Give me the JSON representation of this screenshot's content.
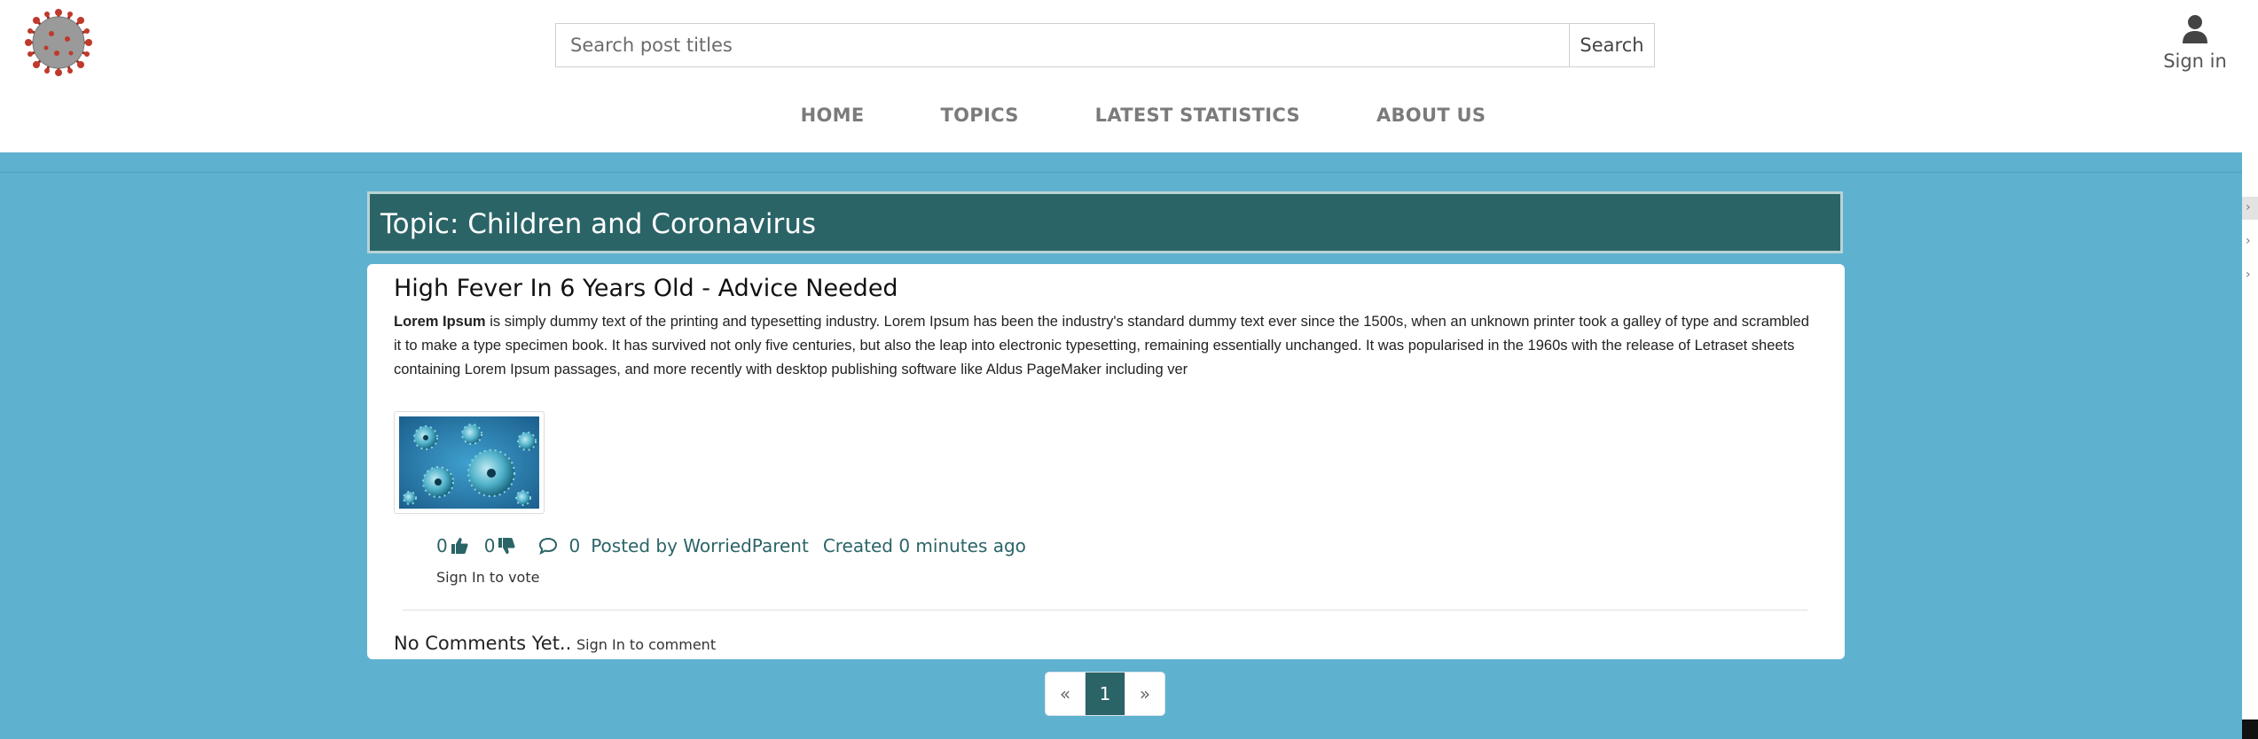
{
  "header": {
    "logo_icon": "coronavirus-logo-icon",
    "search": {
      "placeholder": "Search post titles",
      "button_label": "Search"
    },
    "account": {
      "icon": "user-icon",
      "label": "Sign in"
    }
  },
  "nav": {
    "items": [
      {
        "label": "HOME"
      },
      {
        "label": "TOPICS"
      },
      {
        "label": "LATEST STATISTICS"
      },
      {
        "label": "ABOUT US"
      }
    ]
  },
  "topic": {
    "title": "Topic: Children and Coronavirus"
  },
  "post": {
    "title": "High Fever In 6 Years Old - Advice Needed",
    "body_bold": "Lorem Ipsum",
    "body_text": " is simply dummy text of the printing and typesetting industry. Lorem Ipsum has been the industry's standard dummy text ever since the 1500s, when an unknown printer took a galley of type and scrambled it to make a type specimen book. It has survived not only five centuries, but also the leap into electronic typesetting, remaining essentially unchanged. It was popularised in the 1960s with the release of Letraset sheets containing Lorem Ipsum passages, and more recently with desktop publishing software like Aldus PageMaker including ver",
    "image_icon": "virus-image",
    "likes": "0",
    "like_icon": "thumbs-up-icon",
    "dislikes": "0",
    "dislike_icon": "thumbs-down-icon",
    "comment_icon": "comment-icon",
    "comment_count": "0",
    "posted_by": "Posted by WorriedParent",
    "created": "Created 0 minutes ago",
    "vote_note": "Sign In to vote"
  },
  "comments": {
    "empty_label": "No Comments Yet..",
    "sign_in_note": "Sign In to comment"
  },
  "pagination": {
    "prev": "«",
    "current": "1",
    "next": "»"
  },
  "colors": {
    "page_background": "#5fb1d0",
    "topic_header": "#2b6467",
    "accent_text": "#2b6467",
    "nav_text": "#7b7b7b"
  }
}
